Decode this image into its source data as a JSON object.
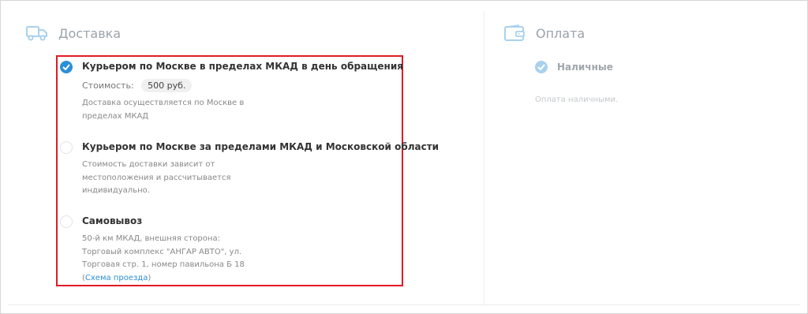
{
  "delivery": {
    "title": "Доставка",
    "icon": "truck-icon",
    "options": [
      {
        "title": "Курьером по Москве в пределах МКАД в день обращения",
        "selected": true,
        "price_label": "Стоимость:",
        "price_value": "500 руб.",
        "description": [
          "Доставка осуществляется по Москве в",
          "пределах МКАД"
        ]
      },
      {
        "title": "Курьером по Москве за пределами МКАД и Московской области",
        "selected": false,
        "description": [
          "Стоимость доставки зависит от",
          "местоположения и рассчитывается",
          "индивидуально."
        ]
      },
      {
        "title": "Самовывоз",
        "selected": false,
        "description": [
          "50-й км МКАД, внешняя сторона:",
          "Торговый комплекс \"АНГАР АВТО\", ул.",
          "Торговая стр. 1, номер павильона Б 18"
        ],
        "link_open": "(",
        "link_text": "Схема проезда",
        "link_close": ")"
      }
    ]
  },
  "payment": {
    "title": "Оплата",
    "icon": "wallet-icon",
    "option_label": "Наличные",
    "option_selected": true,
    "description": "Оплата наличными."
  },
  "colors": {
    "accent": "#2c8ed6",
    "highlight_border": "#e01b24",
    "section_title": "#9aa3ab"
  }
}
